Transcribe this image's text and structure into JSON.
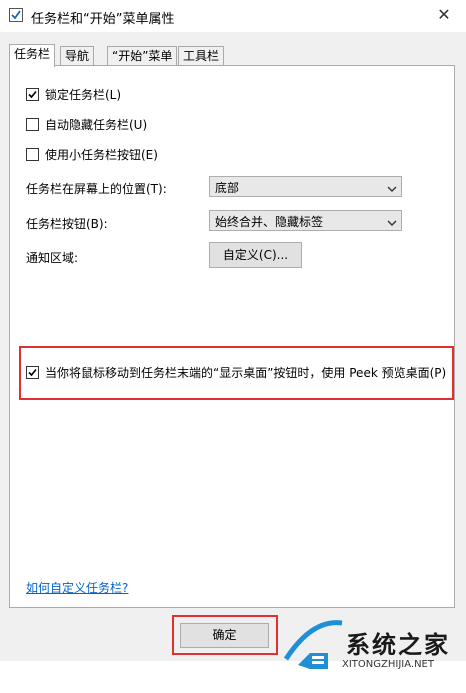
{
  "window": {
    "title": "任务栏和“开始”菜单属性",
    "close_glyph": "✕"
  },
  "tabs": [
    {
      "label": "任务栏",
      "active": true
    },
    {
      "label": "导航",
      "active": false
    },
    {
      "label": "“开始”菜单",
      "active": false
    },
    {
      "label": "工具栏",
      "active": false
    }
  ],
  "options": {
    "lock_taskbar": {
      "label": "锁定任务栏(L)",
      "checked": true
    },
    "auto_hide": {
      "label": "自动隐藏任务栏(U)",
      "checked": false
    },
    "small_buttons": {
      "label": "使用小任务栏按钮(E)",
      "checked": false
    },
    "position": {
      "label": "任务栏在屏幕上的位置(T):",
      "value": "底部"
    },
    "buttons": {
      "label": "任务栏按钮(B):",
      "value": "始终合并、隐藏标签"
    },
    "notify": {
      "label": "通知区域:",
      "button": "自定义(C)..."
    },
    "peek": {
      "label": "当你将鼠标移动到任务栏末端的“显示桌面”按钮时，使用 Peek 预览桌面(P)",
      "checked": true
    }
  },
  "help_link": "如何自定义任务栏?",
  "footer": {
    "ok_label": "确定"
  },
  "watermark": {
    "name": "系统之家",
    "url": "XITONGZHIJIA.NET"
  },
  "colors": {
    "highlight": "#e03030",
    "link": "#0066cc",
    "panel": "#ffffff",
    "dialog": "#f0f0f0"
  }
}
